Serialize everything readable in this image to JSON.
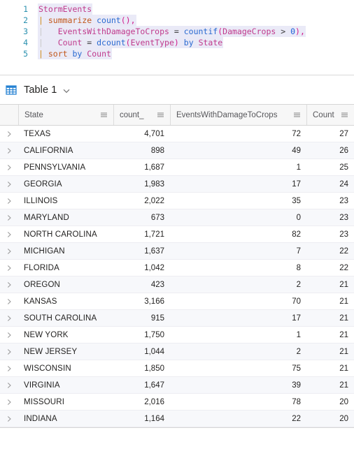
{
  "editor": {
    "lines": [
      {
        "number": "1",
        "tokens": [
          {
            "text": "StormEvents",
            "type": "table"
          }
        ]
      },
      {
        "number": "2",
        "tokens": [
          {
            "text": "| ",
            "type": "pipe"
          },
          {
            "text": "summarize",
            "type": "keyword"
          },
          {
            "text": " ",
            "type": "plain"
          },
          {
            "text": "count",
            "type": "function"
          },
          {
            "text": "(),",
            "type": "punct"
          }
        ]
      },
      {
        "number": "3",
        "tokens": [
          {
            "text": "|   ",
            "type": "guide"
          },
          {
            "text": "EventsWithDamageToCrops",
            "type": "column"
          },
          {
            "text": " = ",
            "type": "operator"
          },
          {
            "text": "countif",
            "type": "function"
          },
          {
            "text": "(",
            "type": "punct"
          },
          {
            "text": "DamageCrops",
            "type": "column"
          },
          {
            "text": " > ",
            "type": "operator"
          },
          {
            "text": "0",
            "type": "number"
          },
          {
            "text": "),",
            "type": "punct"
          }
        ]
      },
      {
        "number": "4",
        "tokens": [
          {
            "text": "|   ",
            "type": "guide"
          },
          {
            "text": "Count",
            "type": "column"
          },
          {
            "text": " = ",
            "type": "operator"
          },
          {
            "text": "dcount",
            "type": "function"
          },
          {
            "text": "(",
            "type": "punct"
          },
          {
            "text": "EventType",
            "type": "column"
          },
          {
            "text": ")",
            "type": "punct"
          },
          {
            "text": " ",
            "type": "plain"
          },
          {
            "text": "by",
            "type": "by"
          },
          {
            "text": " ",
            "type": "plain"
          },
          {
            "text": "State",
            "type": "column"
          }
        ]
      },
      {
        "number": "5",
        "tokens": [
          {
            "text": "| ",
            "type": "pipe"
          },
          {
            "text": "sort",
            "type": "keyword"
          },
          {
            "text": " ",
            "type": "plain"
          },
          {
            "text": "by",
            "type": "by"
          },
          {
            "text": " ",
            "type": "plain"
          },
          {
            "text": "Count",
            "type": "column"
          }
        ]
      }
    ]
  },
  "results": {
    "table_label": "Table 1",
    "table_icon": "table-grid-icon",
    "expand_icon": "chevron-down-icon",
    "columns": [
      {
        "key": "state",
        "label": "State",
        "align": "left",
        "menu_icon": "column-menu-icon"
      },
      {
        "key": "count",
        "label": "count_",
        "align": "right",
        "menu_icon": "column-menu-icon"
      },
      {
        "key": "ewdc",
        "label": "EventsWithDamageToCrops",
        "align": "right",
        "menu_icon": "column-menu-icon"
      },
      {
        "key": "cnt",
        "label": "Count",
        "align": "right",
        "menu_icon": "column-menu-icon"
      }
    ],
    "row_expander_icon": "chevron-right-icon",
    "rows": [
      {
        "state": "TEXAS",
        "count": "4,701",
        "ewdc": "72",
        "cnt": "27"
      },
      {
        "state": "CALIFORNIA",
        "count": "898",
        "ewdc": "49",
        "cnt": "26"
      },
      {
        "state": "PENNSYLVANIA",
        "count": "1,687",
        "ewdc": "1",
        "cnt": "25"
      },
      {
        "state": "GEORGIA",
        "count": "1,983",
        "ewdc": "17",
        "cnt": "24"
      },
      {
        "state": "ILLINOIS",
        "count": "2,022",
        "ewdc": "35",
        "cnt": "23"
      },
      {
        "state": "MARYLAND",
        "count": "673",
        "ewdc": "0",
        "cnt": "23"
      },
      {
        "state": "NORTH CAROLINA",
        "count": "1,721",
        "ewdc": "82",
        "cnt": "23"
      },
      {
        "state": "MICHIGAN",
        "count": "1,637",
        "ewdc": "7",
        "cnt": "22"
      },
      {
        "state": "FLORIDA",
        "count": "1,042",
        "ewdc": "8",
        "cnt": "22"
      },
      {
        "state": "OREGON",
        "count": "423",
        "ewdc": "2",
        "cnt": "21"
      },
      {
        "state": "KANSAS",
        "count": "3,166",
        "ewdc": "70",
        "cnt": "21"
      },
      {
        "state": "SOUTH CAROLINA",
        "count": "915",
        "ewdc": "17",
        "cnt": "21"
      },
      {
        "state": "NEW YORK",
        "count": "1,750",
        "ewdc": "1",
        "cnt": "21"
      },
      {
        "state": "NEW JERSEY",
        "count": "1,044",
        "ewdc": "2",
        "cnt": "21"
      },
      {
        "state": "WISCONSIN",
        "count": "1,850",
        "ewdc": "75",
        "cnt": "21"
      },
      {
        "state": "VIRGINIA",
        "count": "1,647",
        "ewdc": "39",
        "cnt": "21"
      },
      {
        "state": "MISSOURI",
        "count": "2,016",
        "ewdc": "78",
        "cnt": "20"
      },
      {
        "state": "INDIANA",
        "count": "1,164",
        "ewdc": "22",
        "cnt": "20"
      }
    ]
  },
  "colors": {
    "accent": "#1a7bd0",
    "table_name": "#c03a8c",
    "keyword": "#c2571a",
    "function": "#2a6ad1",
    "punct": "#d11a8c",
    "line_number": "#2b91af",
    "row_alt": "#f7f8fb",
    "header_bg": "#f7f7f7"
  }
}
